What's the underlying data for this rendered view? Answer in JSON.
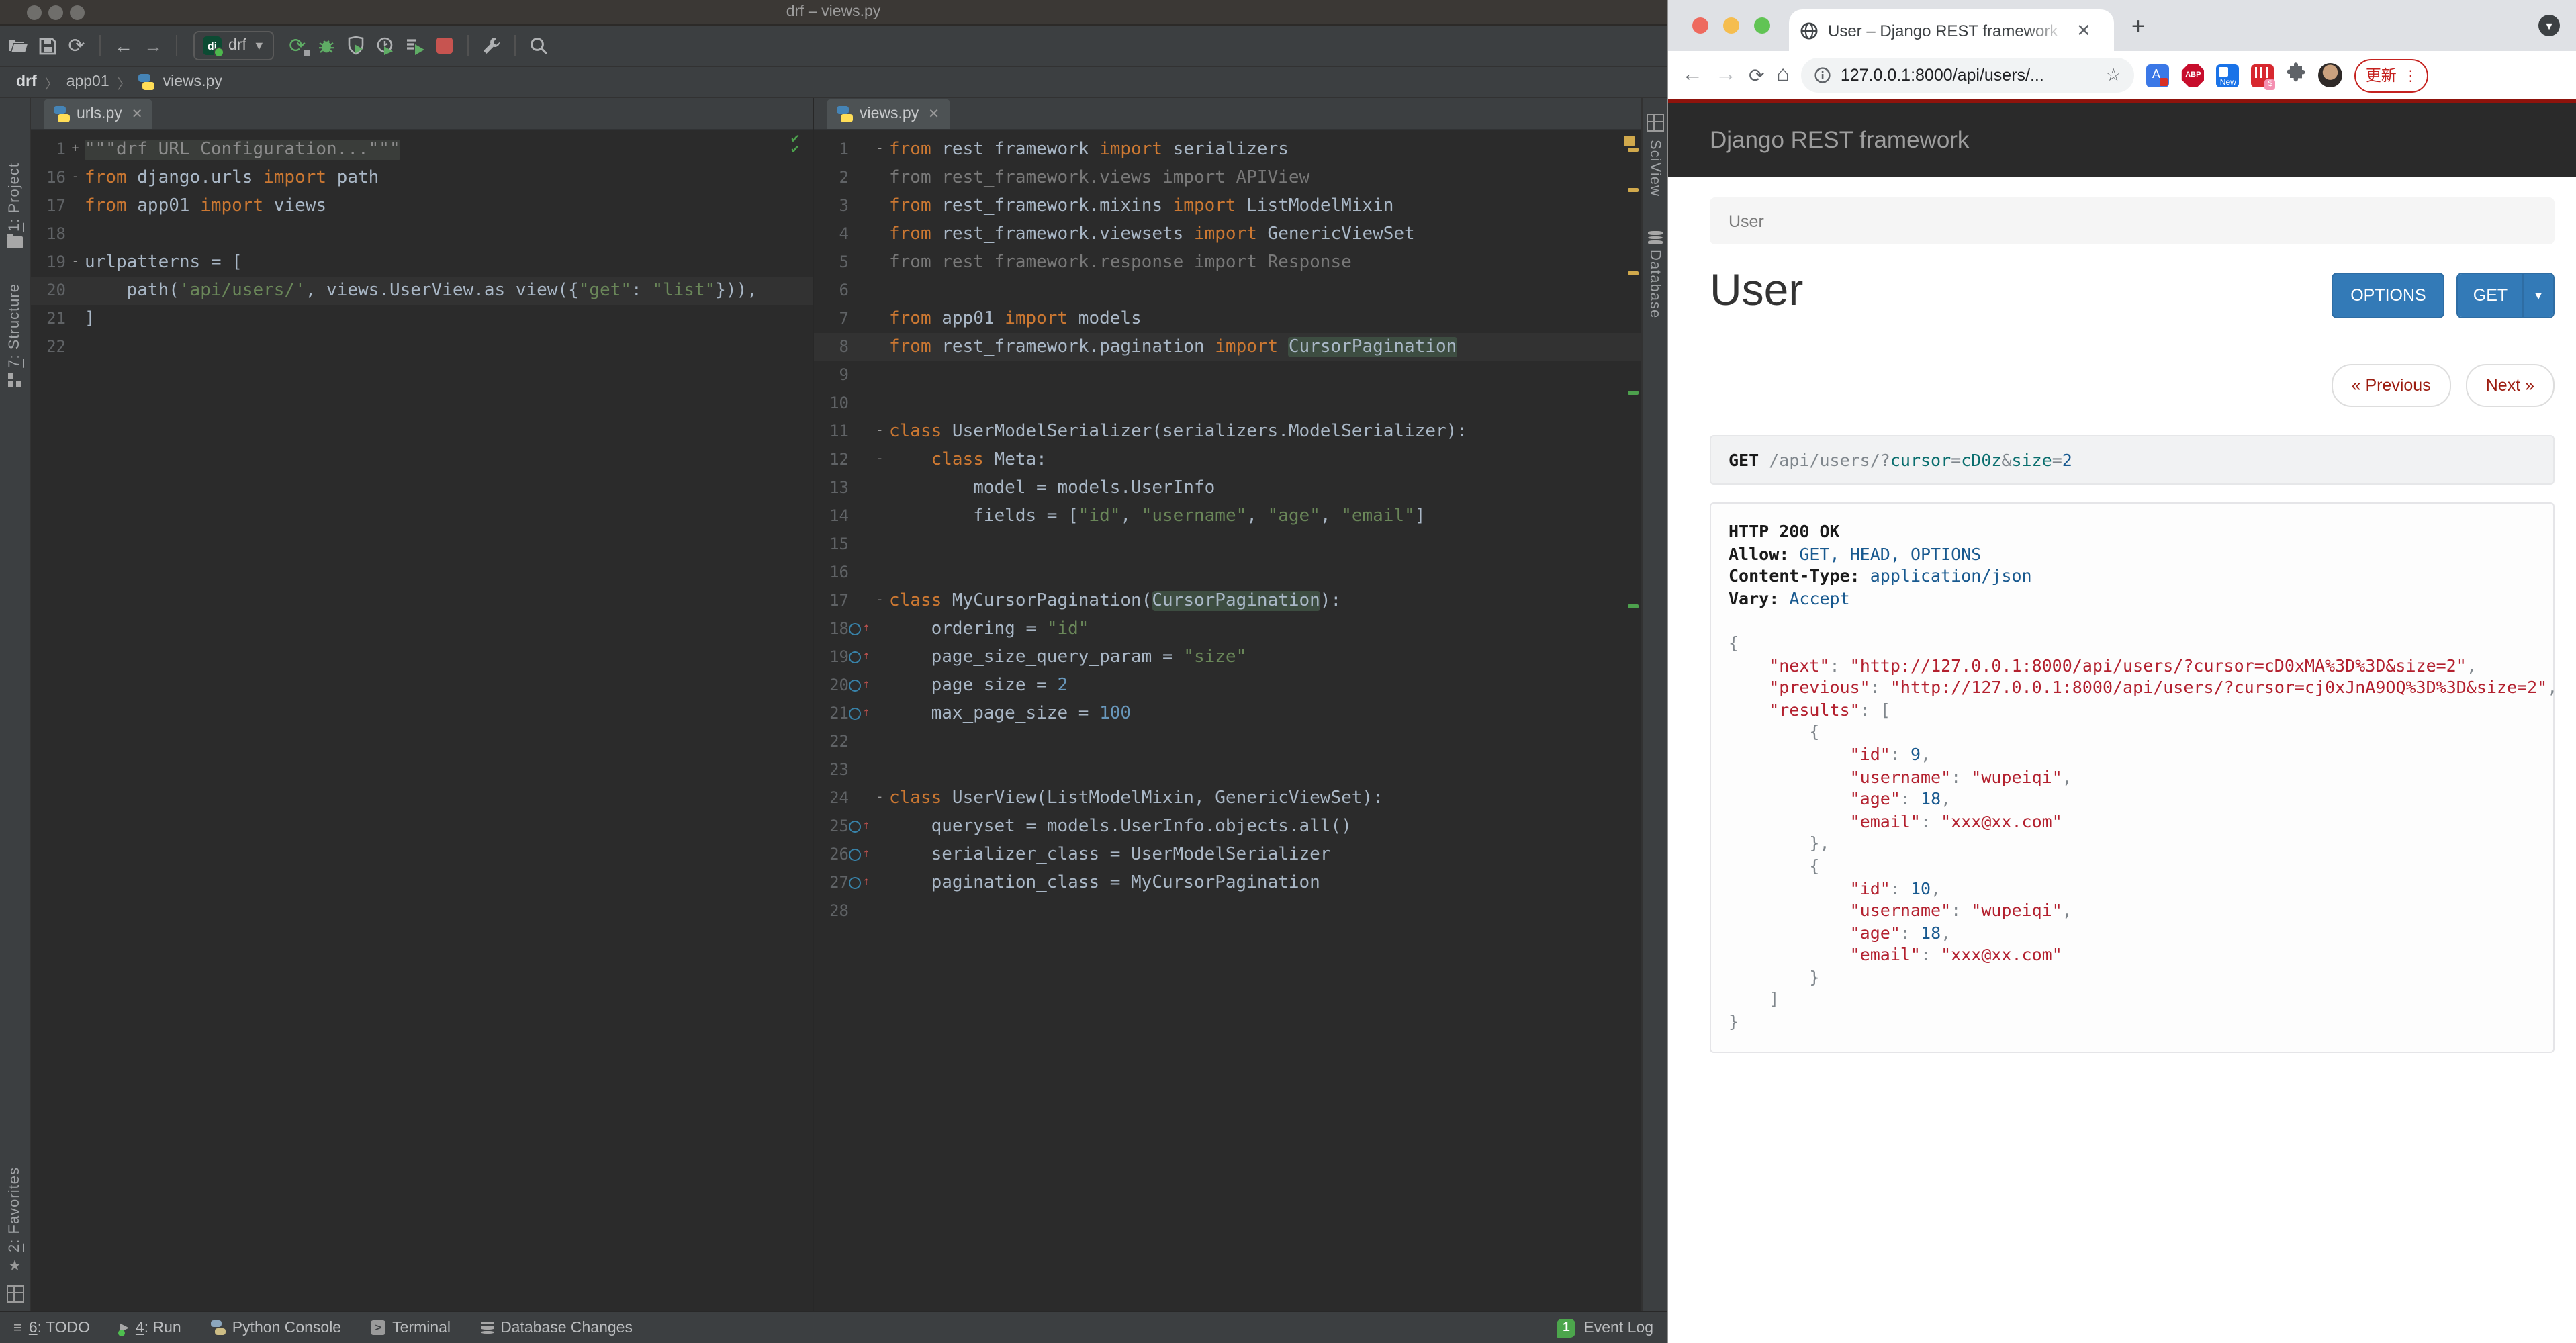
{
  "pycharm": {
    "window_title": "drf – views.py",
    "toolbar": {
      "run_config": "drf"
    },
    "breadcrumbs": [
      "drf",
      "app01",
      "views.py"
    ],
    "left_strip": [
      {
        "key": "1",
        "rest": ": Project"
      },
      {
        "key": "7",
        "rest": ": Structure"
      },
      {
        "key": "2",
        "rest": ": Favorites"
      }
    ],
    "right_strip": [
      "SciView",
      "Database"
    ],
    "editors": [
      {
        "tab": "urls.py",
        "ovcol": false,
        "lines": [
          {
            "n": "1",
            "f": "+",
            "seg": [
              [
                "\"\"\"drf URL Configuration...\"\"\"",
                "d"
              ]
            ]
          },
          {
            "n": "16",
            "f": "-",
            "seg": [
              [
                "from",
                "k"
              ],
              [
                " django.urls ",
                "t"
              ],
              [
                "import",
                "k"
              ],
              [
                " path",
                "t"
              ]
            ]
          },
          {
            "n": "17",
            "seg": [
              [
                "from",
                "k"
              ],
              [
                " app01 ",
                "t"
              ],
              [
                "import",
                "k"
              ],
              [
                " views",
                "t"
              ]
            ]
          },
          {
            "n": "18",
            "seg": []
          },
          {
            "n": "19",
            "f": "-",
            "seg": [
              [
                "urlpatterns = [",
                "t"
              ]
            ]
          },
          {
            "n": "20",
            "cur": true,
            "seg": [
              [
                "    path(",
                "t"
              ],
              [
                "'api/users/'",
                "s"
              ],
              [
                ", views.UserView.as_view({",
                "t"
              ],
              [
                "\"get\"",
                "s"
              ],
              [
                ": ",
                "t"
              ],
              [
                "\"list\"",
                "s"
              ],
              [
                "})),",
                "t"
              ]
            ]
          },
          {
            "n": "21",
            "seg": [
              [
                "]",
                "t"
              ]
            ]
          },
          {
            "n": "22",
            "seg": []
          }
        ]
      },
      {
        "tab": "views.py",
        "ovcol": true,
        "lines": [
          {
            "n": "1",
            "f": "-",
            "seg": [
              [
                "from",
                "k"
              ],
              [
                " rest_framework ",
                "t"
              ],
              [
                "import",
                "k"
              ],
              [
                " serializers",
                "t"
              ]
            ]
          },
          {
            "n": "2",
            "seg": [
              [
                "from rest_framework.views import APIView",
                "g"
              ]
            ]
          },
          {
            "n": "3",
            "seg": [
              [
                "from",
                "k"
              ],
              [
                " rest_framework.mixins ",
                "t"
              ],
              [
                "import",
                "k"
              ],
              [
                " ListModelMixin",
                "t"
              ]
            ]
          },
          {
            "n": "4",
            "seg": [
              [
                "from",
                "k"
              ],
              [
                " rest_framework.viewsets ",
                "t"
              ],
              [
                "import",
                "k"
              ],
              [
                " GenericViewSet",
                "t"
              ]
            ]
          },
          {
            "n": "5",
            "seg": [
              [
                "from rest_framework.response import Response",
                "g"
              ]
            ]
          },
          {
            "n": "6",
            "seg": []
          },
          {
            "n": "7",
            "seg": [
              [
                "from",
                "k"
              ],
              [
                " app01 ",
                "t"
              ],
              [
                "import",
                "k"
              ],
              [
                " models",
                "t"
              ]
            ]
          },
          {
            "n": "8",
            "cur": true,
            "seg": [
              [
                "from",
                "k"
              ],
              [
                " rest_framework.pagination ",
                "t"
              ],
              [
                "import",
                "k"
              ],
              [
                " ",
                "t"
              ],
              [
                "CursorPagination",
                "h"
              ]
            ]
          },
          {
            "n": "9",
            "seg": []
          },
          {
            "n": "10",
            "seg": []
          },
          {
            "n": "11",
            "f": "-",
            "seg": [
              [
                "class",
                "k"
              ],
              [
                " UserModelSerializer(serializers.ModelSerializer):",
                "t"
              ]
            ]
          },
          {
            "n": "12",
            "f": "-",
            "seg": [
              [
                "    ",
                "t"
              ],
              [
                "class",
                "k"
              ],
              [
                " Meta:",
                "t"
              ]
            ]
          },
          {
            "n": "13",
            "seg": [
              [
                "        model = models.UserInfo",
                "t"
              ]
            ]
          },
          {
            "n": "14",
            "seg": [
              [
                "        fields = [",
                "t"
              ],
              [
                "\"id\"",
                "s"
              ],
              [
                ", ",
                "t"
              ],
              [
                "\"username\"",
                "s"
              ],
              [
                ", ",
                "t"
              ],
              [
                "\"age\"",
                "s"
              ],
              [
                ", ",
                "t"
              ],
              [
                "\"email\"",
                "s"
              ],
              [
                "]",
                "t"
              ]
            ]
          },
          {
            "n": "15",
            "seg": []
          },
          {
            "n": "16",
            "seg": []
          },
          {
            "n": "17",
            "f": "-",
            "seg": [
              [
                "class",
                "k"
              ],
              [
                " MyCursorPagination(",
                "t"
              ],
              [
                "CursorPagination",
                "h"
              ],
              [
                "):",
                "t"
              ]
            ]
          },
          {
            "n": "18",
            "ov": true,
            "seg": [
              [
                "    ordering = ",
                "t"
              ],
              [
                "\"id\"",
                "s"
              ]
            ]
          },
          {
            "n": "19",
            "ov": true,
            "seg": [
              [
                "    page_size_query_param = ",
                "t"
              ],
              [
                "\"size\"",
                "s"
              ]
            ]
          },
          {
            "n": "20",
            "ov": true,
            "seg": [
              [
                "    page_size = ",
                "t"
              ],
              [
                "2",
                "n"
              ]
            ]
          },
          {
            "n": "21",
            "ov": true,
            "seg": [
              [
                "    max_page_size = ",
                "t"
              ],
              [
                "100",
                "n"
              ]
            ]
          },
          {
            "n": "22",
            "seg": []
          },
          {
            "n": "23",
            "seg": []
          },
          {
            "n": "24",
            "f": "-",
            "seg": [
              [
                "class",
                "k"
              ],
              [
                " UserView(ListModelMixin, GenericViewSet):",
                "t"
              ]
            ]
          },
          {
            "n": "25",
            "ov": true,
            "seg": [
              [
                "    queryset = models.UserInfo.objects.all()",
                "t"
              ]
            ]
          },
          {
            "n": "26",
            "ov": true,
            "seg": [
              [
                "    serializer_class = UserModelSerializer",
                "t"
              ]
            ]
          },
          {
            "n": "27",
            "ov": true,
            "seg": [
              [
                "    pagination_class = MyCursorPagination",
                "t"
              ]
            ]
          },
          {
            "n": "28",
            "seg": []
          }
        ]
      }
    ],
    "status_bar": {
      "items": [
        {
          "key": "6",
          "rest": ": TODO"
        },
        {
          "key": "4",
          "rest": ": Run"
        },
        {
          "label": "Python Console"
        },
        {
          "label": "Terminal"
        },
        {
          "label": "Database Changes"
        }
      ],
      "event_log": {
        "count": "1",
        "label": "Event Log"
      }
    }
  },
  "browser": {
    "tab_title": "User – Django REST framework",
    "url": "127.0.0.1:8000/api/users/...",
    "update_label": "更新",
    "page": {
      "brand": "Django REST framework",
      "breadcrumb": "User",
      "title": "User",
      "options_button": "OPTIONS",
      "get_button": "GET",
      "prev_button": "« Previous",
      "next_button": "Next »",
      "request_segments": [
        [
          "GET",
          "b"
        ],
        [
          " ",
          "p"
        ],
        [
          "/api/users/?",
          "p"
        ],
        [
          "cursor",
          "c"
        ],
        [
          "=",
          "p"
        ],
        [
          "cD0z",
          "c"
        ],
        [
          "&",
          "p"
        ],
        [
          "size",
          "c"
        ],
        [
          "=",
          "p"
        ],
        [
          "2",
          "u"
        ]
      ],
      "response_lines": [
        [
          [
            "HTTP 200 OK",
            "b"
          ]
        ],
        [
          [
            "Allow:",
            "b"
          ],
          [
            " ",
            "p"
          ],
          [
            "GET, HEAD, OPTIONS",
            "u"
          ]
        ],
        [
          [
            "Content-Type:",
            "b"
          ],
          [
            " ",
            "p"
          ],
          [
            "application/json",
            "u"
          ]
        ],
        [
          [
            "Vary:",
            "b"
          ],
          [
            " ",
            "p"
          ],
          [
            "Accept",
            "u"
          ]
        ],
        [
          [
            " ",
            "p"
          ]
        ],
        [
          [
            "{",
            "p"
          ]
        ],
        [
          [
            "    ",
            "p"
          ],
          [
            "\"next\"",
            "r"
          ],
          [
            ": ",
            "p"
          ],
          [
            "\"http://127.0.0.1:8000/api/users/?cursor=cD0xMA%3D%3D&size=2\"",
            "r"
          ],
          [
            ",",
            "p"
          ]
        ],
        [
          [
            "    ",
            "p"
          ],
          [
            "\"previous\"",
            "r"
          ],
          [
            ": ",
            "p"
          ],
          [
            "\"http://127.0.0.1:8000/api/users/?cursor=cj0xJnA9OQ%3D%3D&size=2\"",
            "r"
          ],
          [
            ",",
            "p"
          ]
        ],
        [
          [
            "    ",
            "p"
          ],
          [
            "\"results\"",
            "r"
          ],
          [
            ": ",
            "p"
          ],
          [
            "[",
            "p"
          ]
        ],
        [
          [
            "        {",
            "p"
          ]
        ],
        [
          [
            "            ",
            "p"
          ],
          [
            "\"id\"",
            "r"
          ],
          [
            ": ",
            "p"
          ],
          [
            "9",
            "u"
          ],
          [
            ",",
            "p"
          ]
        ],
        [
          [
            "            ",
            "p"
          ],
          [
            "\"username\"",
            "r"
          ],
          [
            ": ",
            "p"
          ],
          [
            "\"wupeiqi\"",
            "r"
          ],
          [
            ",",
            "p"
          ]
        ],
        [
          [
            "            ",
            "p"
          ],
          [
            "\"age\"",
            "r"
          ],
          [
            ": ",
            "p"
          ],
          [
            "18",
            "u"
          ],
          [
            ",",
            "p"
          ]
        ],
        [
          [
            "            ",
            "p"
          ],
          [
            "\"email\"",
            "r"
          ],
          [
            ": ",
            "p"
          ],
          [
            "\"xxx@xx.com\"",
            "r"
          ]
        ],
        [
          [
            "        },",
            "p"
          ]
        ],
        [
          [
            "        {",
            "p"
          ]
        ],
        [
          [
            "            ",
            "p"
          ],
          [
            "\"id\"",
            "r"
          ],
          [
            ": ",
            "p"
          ],
          [
            "10",
            "u"
          ],
          [
            ",",
            "p"
          ]
        ],
        [
          [
            "            ",
            "p"
          ],
          [
            "\"username\"",
            "r"
          ],
          [
            ": ",
            "p"
          ],
          [
            "\"wupeiqi\"",
            "r"
          ],
          [
            ",",
            "p"
          ]
        ],
        [
          [
            "            ",
            "p"
          ],
          [
            "\"age\"",
            "r"
          ],
          [
            ": ",
            "p"
          ],
          [
            "18",
            "u"
          ],
          [
            ",",
            "p"
          ]
        ],
        [
          [
            "            ",
            "p"
          ],
          [
            "\"email\"",
            "r"
          ],
          [
            ": ",
            "p"
          ],
          [
            "\"xxx@xx.com\"",
            "r"
          ]
        ],
        [
          [
            "        }",
            "p"
          ]
        ],
        [
          [
            "    ]",
            "p"
          ]
        ],
        [
          [
            "}",
            "p"
          ]
        ]
      ]
    }
  }
}
